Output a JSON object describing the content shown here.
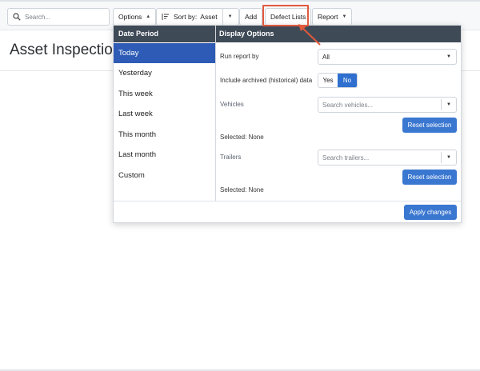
{
  "toolbar": {
    "search_placeholder": "Search...",
    "options_label": "Options",
    "sort_label": "Sort by:",
    "sort_value": "Asset",
    "add_label": "Add",
    "defect_lists_label": "Defect Lists",
    "report_label": "Report"
  },
  "page": {
    "title": "Asset Inspection"
  },
  "dropdown": {
    "date_period_header": "Date Period",
    "display_options_header": "Display Options",
    "periods": [
      "Today",
      "Yesterday",
      "This week",
      "Last week",
      "This month",
      "Last month",
      "Custom"
    ],
    "active_period": "Today",
    "run_report_by_label": "Run report by",
    "run_report_by_value": "All",
    "include_archived_label": "Include archived (historical) data",
    "yes_label": "Yes",
    "no_label": "No",
    "vehicles_label": "Vehicles",
    "vehicles_placeholder": "Search vehicles...",
    "vehicles_reset": "Reset selection",
    "vehicles_selected": "Selected: None",
    "trailers_label": "Trailers",
    "trailers_placeholder": "Search trailers...",
    "trailers_reset": "Reset selection",
    "trailers_selected": "Selected: None",
    "apply_label": "Apply changes"
  },
  "colors": {
    "accent": "#2e5bb5",
    "header_bg": "#3f4a57",
    "highlight": "#e15a3d"
  },
  "icons": {
    "search": "search-icon",
    "sort": "sort-icon",
    "caret": "chevron-down-icon"
  }
}
